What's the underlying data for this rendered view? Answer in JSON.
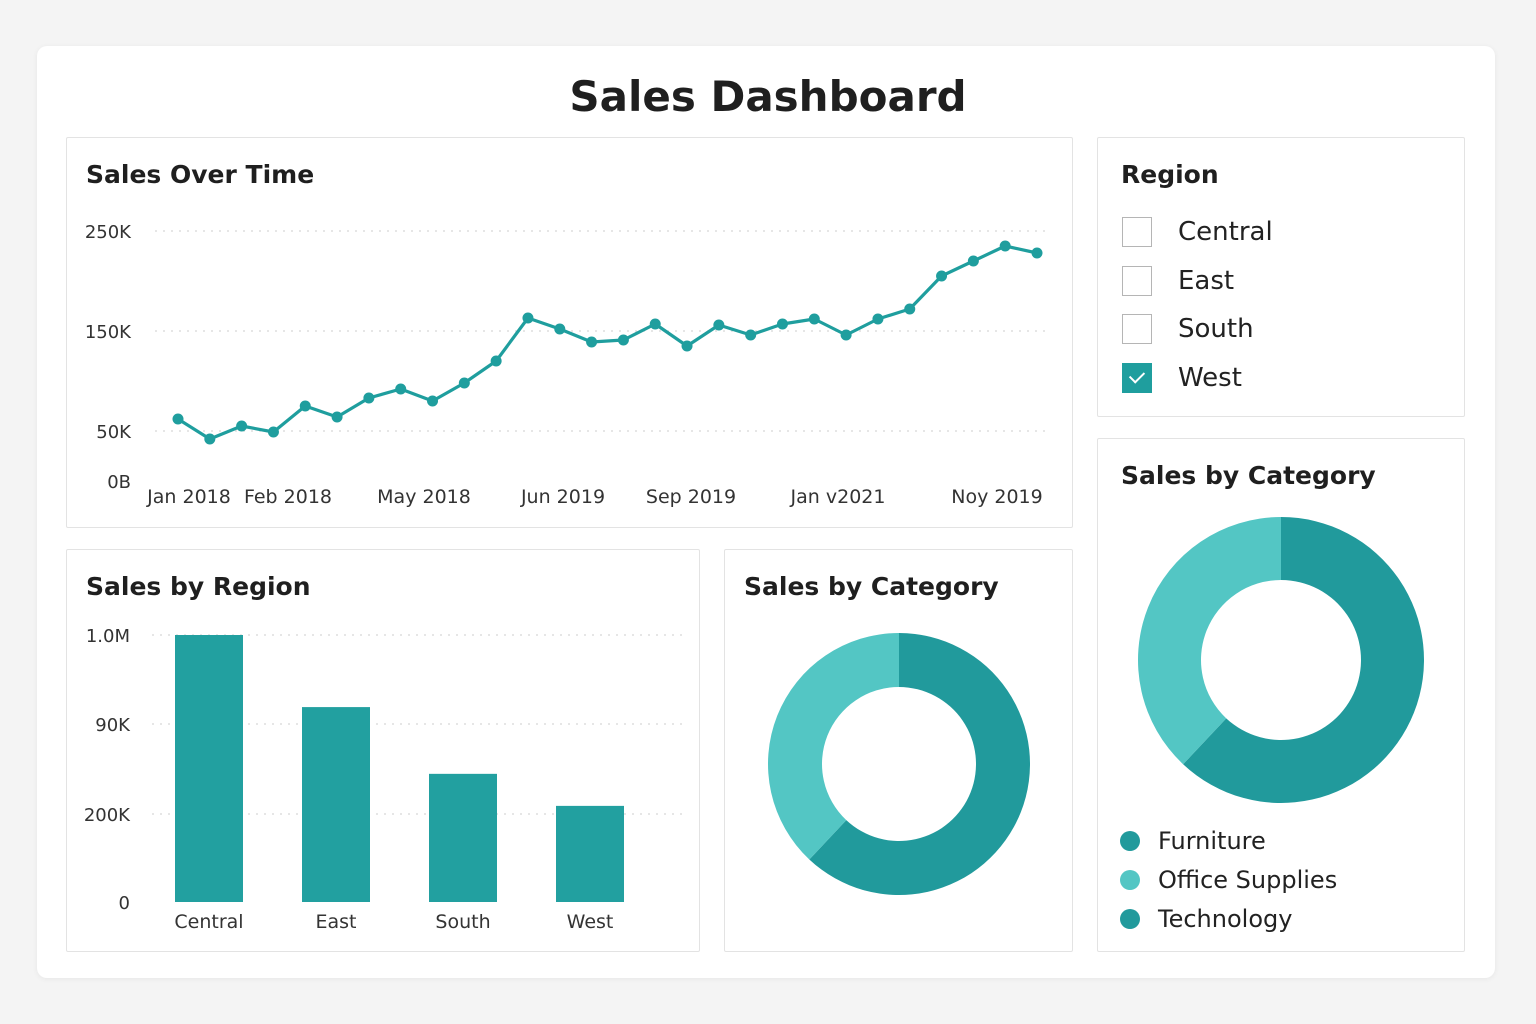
{
  "dashboard": {
    "title": "Sales Dashboard"
  },
  "colors": {
    "accent": "#1f9e9e",
    "dark_teal": "#219a9c",
    "light_teal": "#53c6c4",
    "bar": "#22a0a0",
    "gridline": "#d6d6d6",
    "card_border": "#e3e3e3"
  },
  "region_slicer": {
    "title": "Region",
    "items": [
      {
        "label": "Central",
        "checked": false
      },
      {
        "label": "East",
        "checked": false
      },
      {
        "label": "South",
        "checked": false
      },
      {
        "label": "West",
        "checked": true
      }
    ]
  },
  "chart_data": [
    {
      "id": "sales_over_time",
      "type": "line",
      "title": "Sales Over Time",
      "y_ticks": [
        "250K",
        "150K",
        "50K",
        "0B"
      ],
      "x_tick_labels": [
        "Jan 2018",
        "Feb 2018",
        "May 2018",
        "Jun 2019",
        "Sep 2019",
        "Jan v2021",
        "Noy 2019"
      ],
      "ylim": [
        0,
        250000
      ],
      "grid": true,
      "series": [
        {
          "values": [
            62000,
            42000,
            55000,
            49000,
            75000,
            64000,
            83000,
            92000,
            80000,
            98000,
            120000,
            163000,
            152000,
            139000,
            141000,
            157000,
            135000,
            156000,
            146000,
            157000,
            162000,
            146000,
            162000,
            172000,
            205000,
            220000,
            235000,
            228000
          ]
        }
      ]
    },
    {
      "id": "sales_by_region",
      "type": "bar",
      "title": "Sales by Region",
      "categories": [
        "Central",
        "East",
        "South",
        "West"
      ],
      "values": [
        1000000,
        730000,
        480000,
        360000
      ],
      "y_ticks": [
        "1.0M",
        "90K",
        "200K",
        "0"
      ],
      "ylim": [
        0,
        1000000
      ],
      "grid": true
    },
    {
      "id": "sales_by_category_small",
      "type": "pie",
      "title": "Sales by Category",
      "slices": [
        {
          "label": "Furniture",
          "value": 0.62
        },
        {
          "label": "Office Supplies",
          "value": 0.38
        }
      ]
    },
    {
      "id": "sales_by_category_large",
      "type": "pie",
      "title": "Sales by Category",
      "slices": [
        {
          "label": "Furniture",
          "value": 0.62
        },
        {
          "label": "Office Supplies",
          "value": 0.38
        }
      ],
      "legend": [
        {
          "label": "Furniture",
          "color": "#219a9c"
        },
        {
          "label": "Office Supplies",
          "color": "#53c6c4"
        },
        {
          "label": "Technology",
          "color": "#219a9c"
        }
      ],
      "legend_position": "bottom"
    }
  ]
}
